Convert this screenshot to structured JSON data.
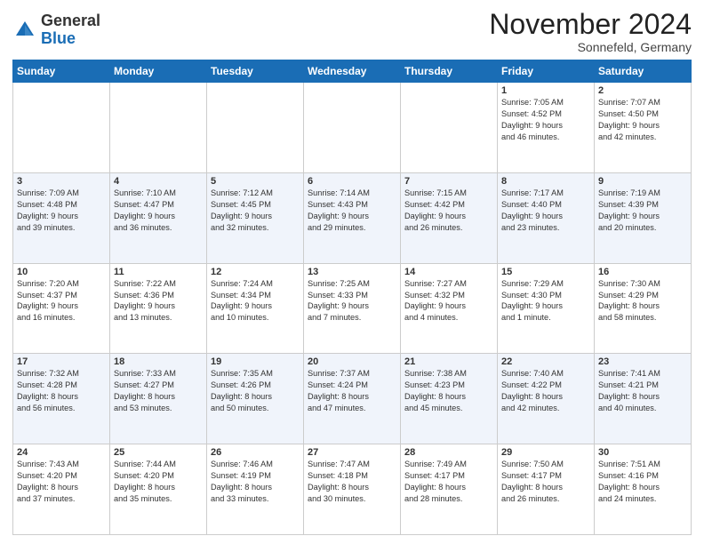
{
  "logo": {
    "general": "General",
    "blue": "Blue"
  },
  "header": {
    "month": "November 2024",
    "location": "Sonnefeld, Germany"
  },
  "weekdays": [
    "Sunday",
    "Monday",
    "Tuesday",
    "Wednesday",
    "Thursday",
    "Friday",
    "Saturday"
  ],
  "weeks": [
    [
      {
        "day": "",
        "info": ""
      },
      {
        "day": "",
        "info": ""
      },
      {
        "day": "",
        "info": ""
      },
      {
        "day": "",
        "info": ""
      },
      {
        "day": "",
        "info": ""
      },
      {
        "day": "1",
        "info": "Sunrise: 7:05 AM\nSunset: 4:52 PM\nDaylight: 9 hours\nand 46 minutes."
      },
      {
        "day": "2",
        "info": "Sunrise: 7:07 AM\nSunset: 4:50 PM\nDaylight: 9 hours\nand 42 minutes."
      }
    ],
    [
      {
        "day": "3",
        "info": "Sunrise: 7:09 AM\nSunset: 4:48 PM\nDaylight: 9 hours\nand 39 minutes."
      },
      {
        "day": "4",
        "info": "Sunrise: 7:10 AM\nSunset: 4:47 PM\nDaylight: 9 hours\nand 36 minutes."
      },
      {
        "day": "5",
        "info": "Sunrise: 7:12 AM\nSunset: 4:45 PM\nDaylight: 9 hours\nand 32 minutes."
      },
      {
        "day": "6",
        "info": "Sunrise: 7:14 AM\nSunset: 4:43 PM\nDaylight: 9 hours\nand 29 minutes."
      },
      {
        "day": "7",
        "info": "Sunrise: 7:15 AM\nSunset: 4:42 PM\nDaylight: 9 hours\nand 26 minutes."
      },
      {
        "day": "8",
        "info": "Sunrise: 7:17 AM\nSunset: 4:40 PM\nDaylight: 9 hours\nand 23 minutes."
      },
      {
        "day": "9",
        "info": "Sunrise: 7:19 AM\nSunset: 4:39 PM\nDaylight: 9 hours\nand 20 minutes."
      }
    ],
    [
      {
        "day": "10",
        "info": "Sunrise: 7:20 AM\nSunset: 4:37 PM\nDaylight: 9 hours\nand 16 minutes."
      },
      {
        "day": "11",
        "info": "Sunrise: 7:22 AM\nSunset: 4:36 PM\nDaylight: 9 hours\nand 13 minutes."
      },
      {
        "day": "12",
        "info": "Sunrise: 7:24 AM\nSunset: 4:34 PM\nDaylight: 9 hours\nand 10 minutes."
      },
      {
        "day": "13",
        "info": "Sunrise: 7:25 AM\nSunset: 4:33 PM\nDaylight: 9 hours\nand 7 minutes."
      },
      {
        "day": "14",
        "info": "Sunrise: 7:27 AM\nSunset: 4:32 PM\nDaylight: 9 hours\nand 4 minutes."
      },
      {
        "day": "15",
        "info": "Sunrise: 7:29 AM\nSunset: 4:30 PM\nDaylight: 9 hours\nand 1 minute."
      },
      {
        "day": "16",
        "info": "Sunrise: 7:30 AM\nSunset: 4:29 PM\nDaylight: 8 hours\nand 58 minutes."
      }
    ],
    [
      {
        "day": "17",
        "info": "Sunrise: 7:32 AM\nSunset: 4:28 PM\nDaylight: 8 hours\nand 56 minutes."
      },
      {
        "day": "18",
        "info": "Sunrise: 7:33 AM\nSunset: 4:27 PM\nDaylight: 8 hours\nand 53 minutes."
      },
      {
        "day": "19",
        "info": "Sunrise: 7:35 AM\nSunset: 4:26 PM\nDaylight: 8 hours\nand 50 minutes."
      },
      {
        "day": "20",
        "info": "Sunrise: 7:37 AM\nSunset: 4:24 PM\nDaylight: 8 hours\nand 47 minutes."
      },
      {
        "day": "21",
        "info": "Sunrise: 7:38 AM\nSunset: 4:23 PM\nDaylight: 8 hours\nand 45 minutes."
      },
      {
        "day": "22",
        "info": "Sunrise: 7:40 AM\nSunset: 4:22 PM\nDaylight: 8 hours\nand 42 minutes."
      },
      {
        "day": "23",
        "info": "Sunrise: 7:41 AM\nSunset: 4:21 PM\nDaylight: 8 hours\nand 40 minutes."
      }
    ],
    [
      {
        "day": "24",
        "info": "Sunrise: 7:43 AM\nSunset: 4:20 PM\nDaylight: 8 hours\nand 37 minutes."
      },
      {
        "day": "25",
        "info": "Sunrise: 7:44 AM\nSunset: 4:20 PM\nDaylight: 8 hours\nand 35 minutes."
      },
      {
        "day": "26",
        "info": "Sunrise: 7:46 AM\nSunset: 4:19 PM\nDaylight: 8 hours\nand 33 minutes."
      },
      {
        "day": "27",
        "info": "Sunrise: 7:47 AM\nSunset: 4:18 PM\nDaylight: 8 hours\nand 30 minutes."
      },
      {
        "day": "28",
        "info": "Sunrise: 7:49 AM\nSunset: 4:17 PM\nDaylight: 8 hours\nand 28 minutes."
      },
      {
        "day": "29",
        "info": "Sunrise: 7:50 AM\nSunset: 4:17 PM\nDaylight: 8 hours\nand 26 minutes."
      },
      {
        "day": "30",
        "info": "Sunrise: 7:51 AM\nSunset: 4:16 PM\nDaylight: 8 hours\nand 24 minutes."
      }
    ]
  ]
}
